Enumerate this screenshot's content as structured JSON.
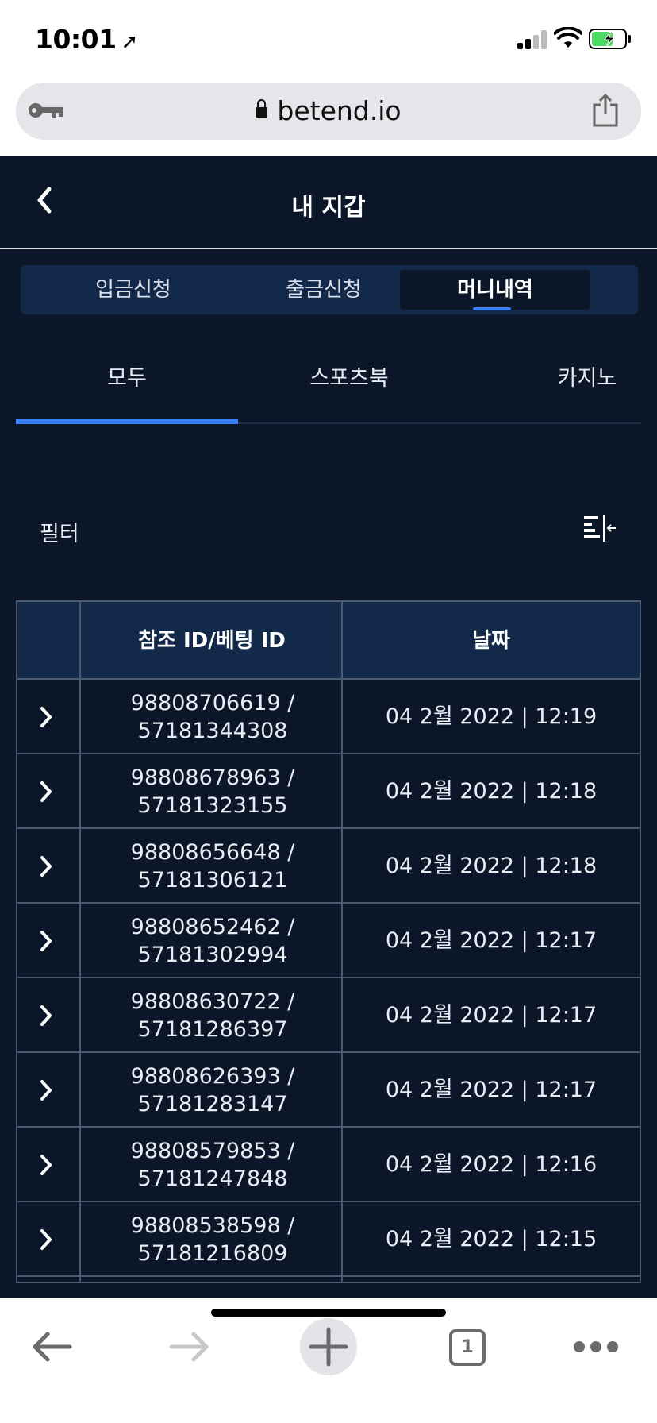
{
  "status": {
    "time": "10:01",
    "location_icon": "location-arrow-icon",
    "signal_icon": "cell-signal-icon",
    "wifi_icon": "wifi-icon",
    "battery_icon": "battery-charging-icon"
  },
  "browser": {
    "url": "betend.io",
    "lock_icon": "lock-icon",
    "key_icon": "key-icon",
    "share_icon": "share-icon",
    "tab_count": "1"
  },
  "header": {
    "title": "내 지갑",
    "back_icon": "back-chevron-icon"
  },
  "segment_tabs": [
    {
      "label": "입금신청",
      "active": false
    },
    {
      "label": "출금신청",
      "active": false
    },
    {
      "label": "머니내역",
      "active": true
    }
  ],
  "category_tabs": [
    {
      "label": "모두",
      "active": true
    },
    {
      "label": "스포츠북",
      "active": false
    },
    {
      "label": "카지노",
      "active": false
    }
  ],
  "filter": {
    "label": "필터",
    "icon": "filter-collapse-icon"
  },
  "table": {
    "headers": [
      "",
      "참조 ID/베팅 ID",
      "날짜"
    ],
    "rows": [
      {
        "ref_id": "98808706619 /",
        "bet_id": "57181344308",
        "date": "04 2월 2022 | 12:19"
      },
      {
        "ref_id": "98808678963 /",
        "bet_id": "57181323155",
        "date": "04 2월 2022 | 12:18"
      },
      {
        "ref_id": "98808656648 /",
        "bet_id": "57181306121",
        "date": "04 2월 2022 | 12:18"
      },
      {
        "ref_id": "98808652462 /",
        "bet_id": "57181302994",
        "date": "04 2월 2022 | 12:17"
      },
      {
        "ref_id": "98808630722 /",
        "bet_id": "57181286397",
        "date": "04 2월 2022 | 12:17"
      },
      {
        "ref_id": "98808626393 /",
        "bet_id": "57181283147",
        "date": "04 2월 2022 | 12:17"
      },
      {
        "ref_id": "98808579853 /",
        "bet_id": "57181247848",
        "date": "04 2월 2022 | 12:16"
      },
      {
        "ref_id": "98808538598 /",
        "bet_id": "57181216809",
        "date": "04 2월 2022 | 12:15"
      }
    ]
  },
  "colors": {
    "background": "#0b1628",
    "panel": "#13294a",
    "accent": "#3b82f6",
    "border": "#4b5a70"
  }
}
